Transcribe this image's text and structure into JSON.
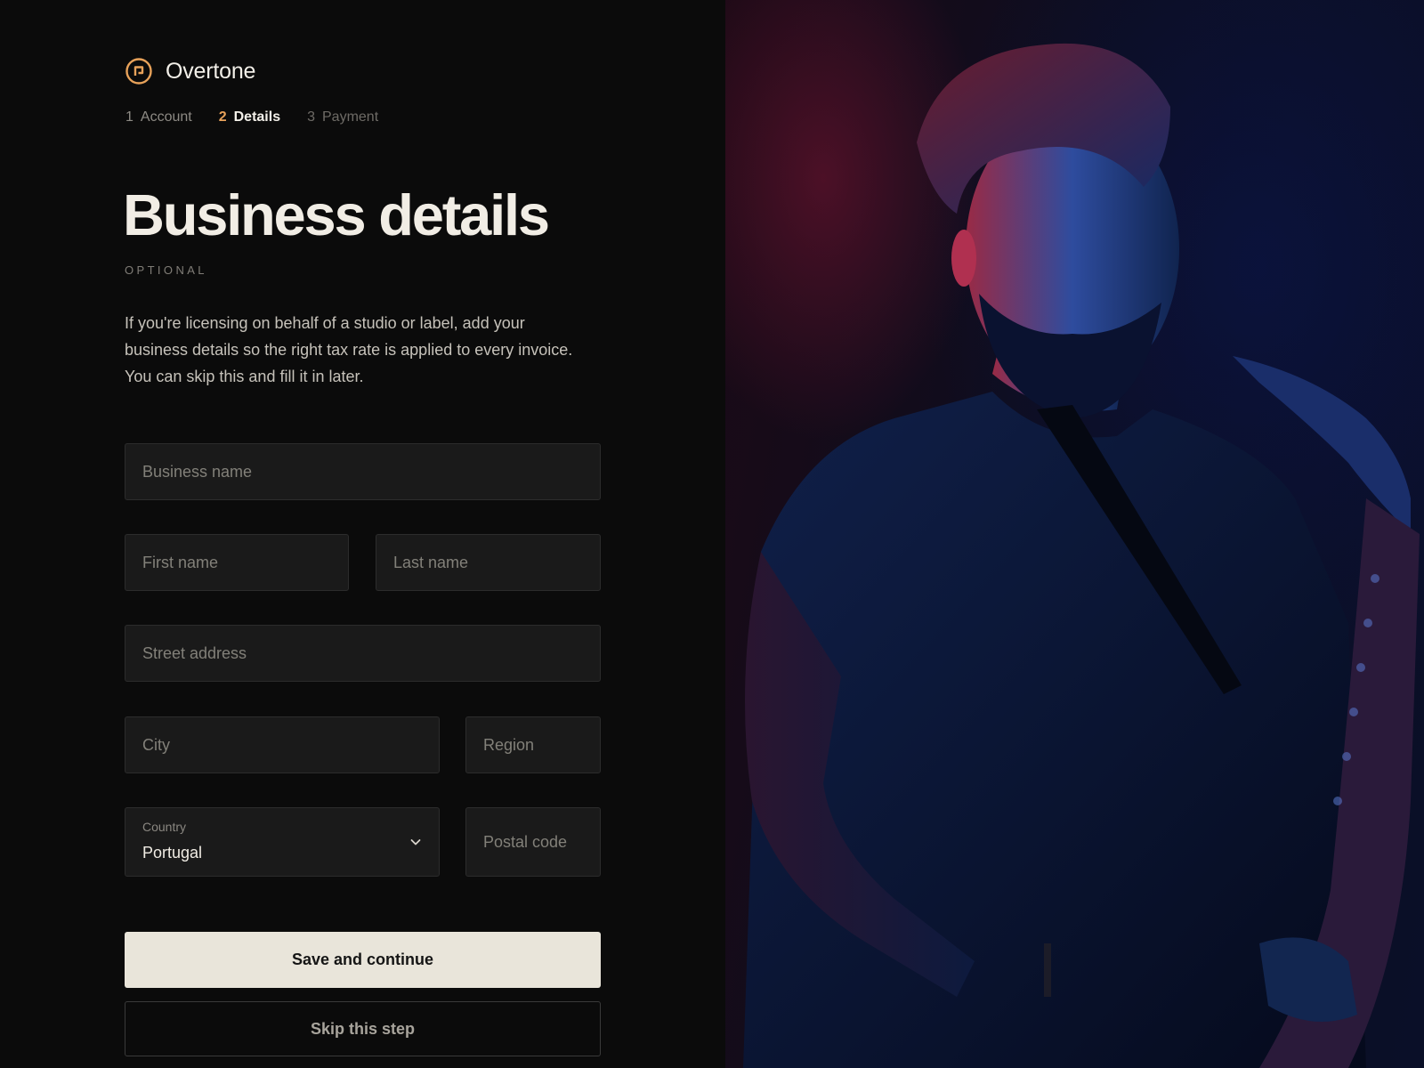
{
  "brand": {
    "name": "Overtone",
    "icon": "overtone-logo-icon",
    "accent": "#e8a25a"
  },
  "steps": [
    {
      "num": "1",
      "label": "Account",
      "state": "done"
    },
    {
      "num": "2",
      "label": "Details",
      "state": "active"
    },
    {
      "num": "3",
      "label": "Payment",
      "state": "upcoming"
    }
  ],
  "page": {
    "title": "Business details",
    "eyebrow": "OPTIONAL",
    "intro": "If you're licensing on behalf of a studio or label, add your business details so the right tax rate is applied to every invoice. You can skip this and fill it in later."
  },
  "form": {
    "business_name": {
      "placeholder": "Business name",
      "value": ""
    },
    "first_name": {
      "placeholder": "First name",
      "value": ""
    },
    "last_name": {
      "placeholder": "Last name",
      "value": ""
    },
    "street": {
      "placeholder": "Street address",
      "value": ""
    },
    "city": {
      "placeholder": "City",
      "value": ""
    },
    "region": {
      "placeholder": "Region",
      "value": ""
    },
    "country": {
      "label": "Country",
      "value": "Portugal",
      "icon": "chevron-down-icon"
    },
    "postal": {
      "placeholder": "Postal code",
      "value": ""
    }
  },
  "actions": {
    "primary": "Save and continue",
    "secondary": "Skip this step"
  },
  "photo": {
    "subject": "saxophonist-photo"
  }
}
